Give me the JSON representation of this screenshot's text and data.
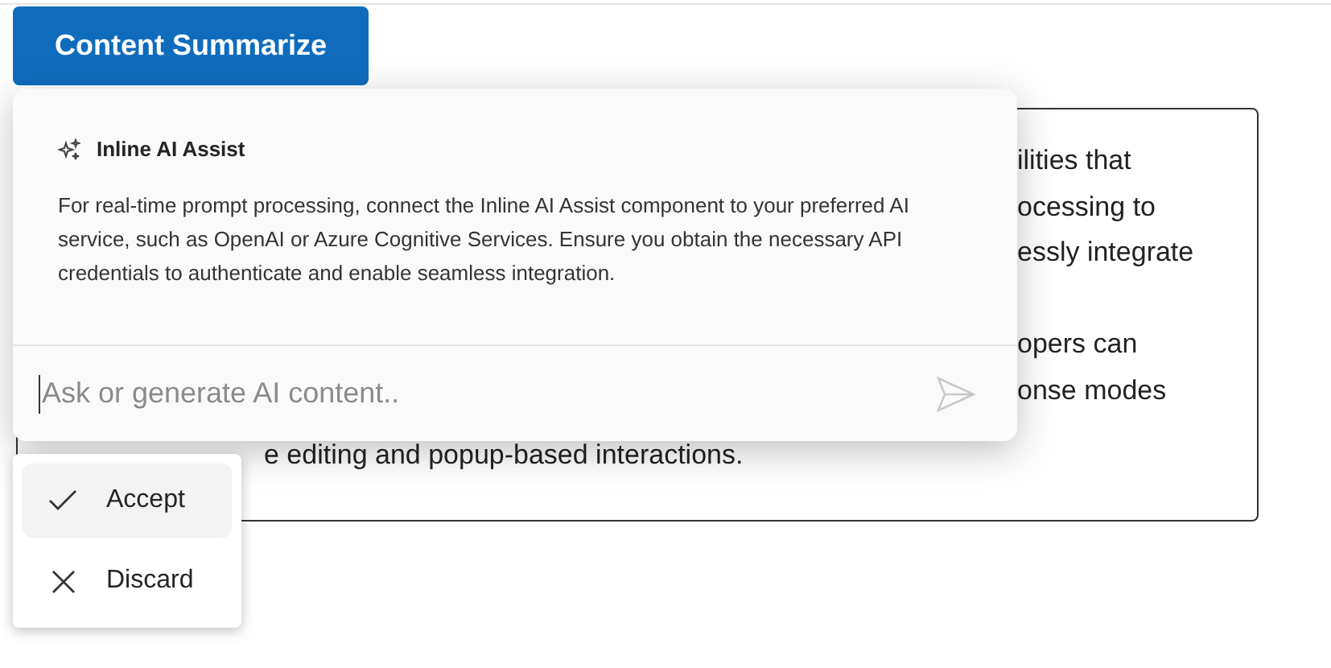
{
  "summarize_button": {
    "label": "Content Summarize"
  },
  "editor": {
    "upper_fragments": [
      "ilities that",
      "ocessing to",
      "essly integrate"
    ],
    "lower_fragments": [
      "opers can",
      "onse modes"
    ],
    "bottom_fragment": "e editing and popup-based interactions."
  },
  "assist_popup": {
    "title": "Inline AI Assist",
    "body": "For real-time prompt processing, connect the Inline AI Assist component to your preferred AI service, such as OpenAI or Azure Cognitive Services. Ensure you obtain the necessary API credentials to authenticate and enable seamless integration.",
    "prompt": {
      "placeholder": "Ask or generate AI content.."
    }
  },
  "action_menu": [
    {
      "kind": "accept",
      "label": "Accept",
      "selected": true
    },
    {
      "kind": "discard",
      "label": "Discard",
      "selected": false
    }
  ]
}
